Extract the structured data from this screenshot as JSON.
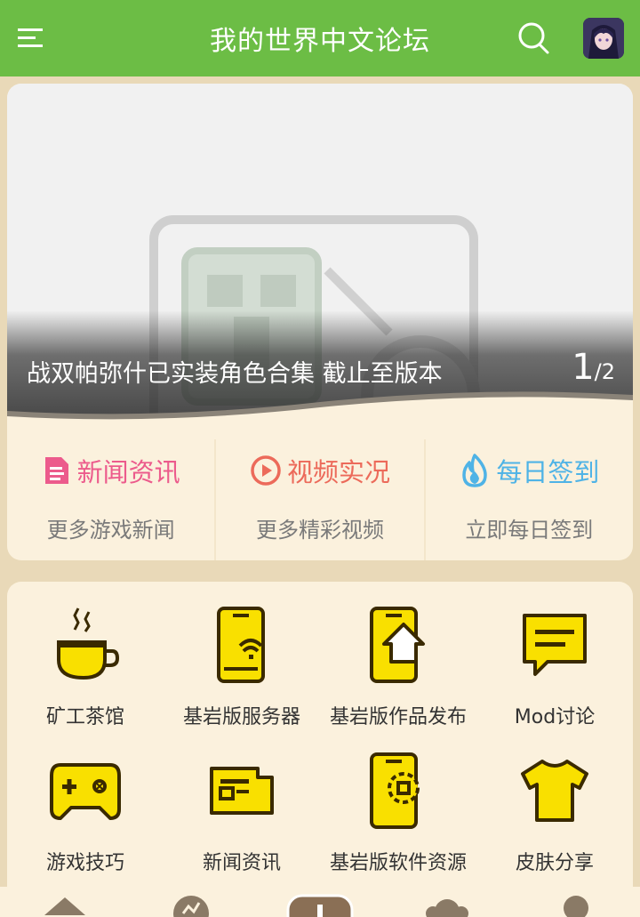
{
  "header": {
    "title": "我的世界中文论坛",
    "menu_icon": "menu-icon",
    "search_icon": "search-icon",
    "avatar": "user-avatar"
  },
  "banner": {
    "caption": "战双帕弥什已实装角色合集 截止至版本",
    "page_current": "1",
    "page_total": "/2"
  },
  "quick_links": [
    {
      "title": "新闻资讯",
      "subtitle": "更多游戏新闻",
      "icon": "news-doc-icon",
      "color": "#ec5b8c"
    },
    {
      "title": "视频实况",
      "subtitle": "更多精彩视频",
      "icon": "play-circle-icon",
      "color": "#ec6a5a"
    },
    {
      "title": "每日签到",
      "subtitle": "立即每日签到",
      "icon": "flame-icon",
      "color": "#4fb3e6"
    }
  ],
  "forums": [
    {
      "label": "矿工茶馆",
      "icon": "tea-cup-icon"
    },
    {
      "label": "基岩版服务器",
      "icon": "phone-wifi-icon"
    },
    {
      "label": "基岩版作品发布",
      "icon": "phone-upload-icon"
    },
    {
      "label": "Mod讨论",
      "icon": "chat-bubble-icon"
    },
    {
      "label": "游戏技巧",
      "icon": "gamepad-icon"
    },
    {
      "label": "新闻资讯",
      "icon": "newspaper-icon"
    },
    {
      "label": "基岩版软件资源",
      "icon": "phone-gear-icon"
    },
    {
      "label": "皮肤分享",
      "icon": "tshirt-icon"
    }
  ],
  "colors": {
    "header_bg": "#6cbd45",
    "page_bg": "#e9d9b8",
    "card_bg": "#fbf1dd",
    "forum_icon_fill": "#f9e000",
    "forum_icon_stroke": "#3a2a00"
  }
}
